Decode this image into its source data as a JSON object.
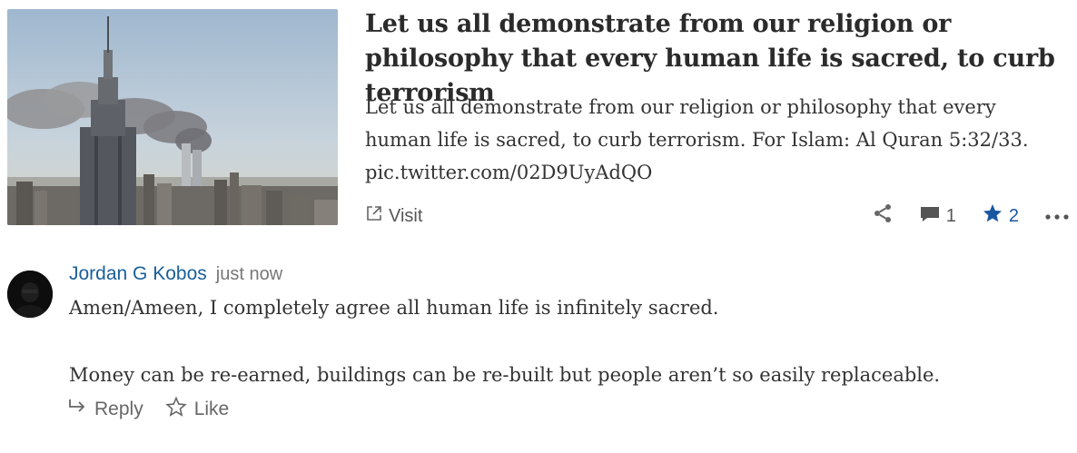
{
  "post": {
    "title": "Let us all demonstrate from our religion or philosophy that every human life is sacred, to curb terrorism",
    "body": "Let us all demonstrate from our religion or philosophy that every human life is sacred, to curb terrorism. For Islam: Al Quran 5:32/33. pic.twitter.com/02D9UyAdQO",
    "visit_label": "Visit",
    "comment_count": "1",
    "star_count": "2"
  },
  "comment": {
    "author": "Jordan G Kobos",
    "time": "just now",
    "paragraph1": "Amen/Ameen, I completely agree all human life is infinitely sacred.",
    "paragraph2": "Money can be re-earned, buildings can be re-built but people aren’t so easily replaceable.",
    "reply_label": "Reply",
    "like_label": "Like"
  },
  "icons": {
    "external_link": "external-link-icon",
    "share": "share-icon",
    "comment": "comment-icon",
    "star": "star-icon",
    "more": "more-icon",
    "reply": "reply-icon",
    "like": "star-outline-icon"
  },
  "colors": {
    "link_blue": "#1a5f99",
    "star_blue": "#1a56a0"
  }
}
